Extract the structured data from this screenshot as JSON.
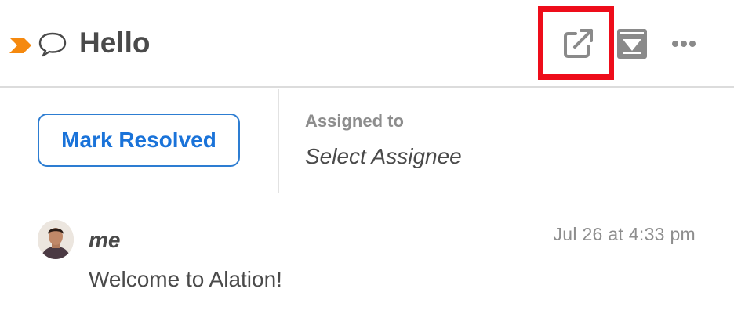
{
  "header": {
    "title": "Hello",
    "icons": {
      "flag": "flag-icon",
      "conversation": "speech-bubble-icon",
      "open_external": "external-link-icon",
      "download": "download-icon",
      "more": "more-dots-icon"
    }
  },
  "actions": {
    "resolve_label": "Mark Resolved",
    "assigned_label": "Assigned to",
    "assignee_placeholder": "Select Assignee"
  },
  "comment": {
    "author": "me",
    "timestamp": "Jul 26 at 4:33 pm",
    "body": "Welcome to Alation!"
  },
  "colors": {
    "accent": "#1a73d9",
    "flag": "#f5890f",
    "icon_gray": "#8a8a8a",
    "highlight": "#ee0d1a",
    "text": "#4a4a4a",
    "muted": "#8d8d8d"
  }
}
